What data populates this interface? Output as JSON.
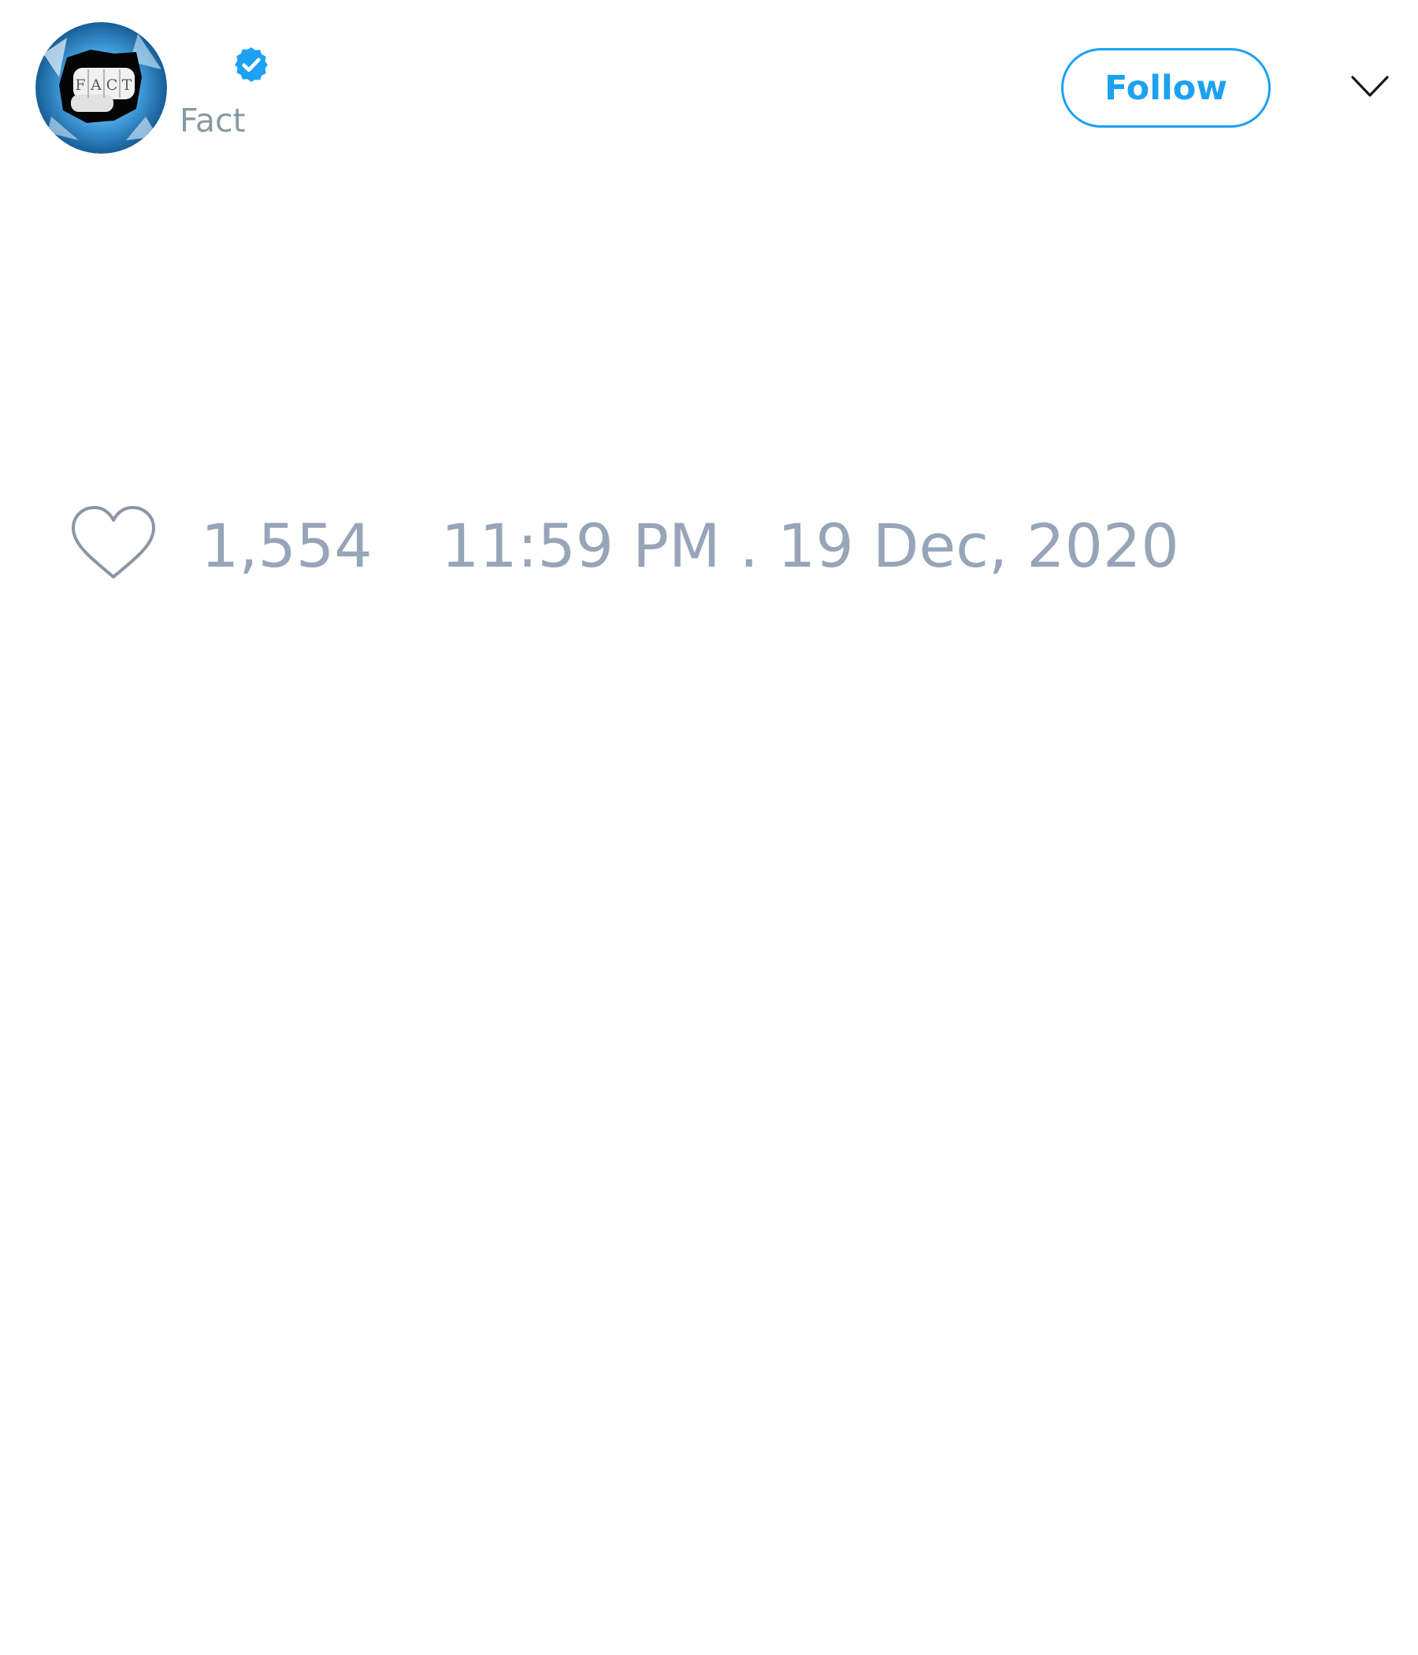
{
  "user": {
    "handle": "Fact",
    "avatar_text": "FACT",
    "verified": true,
    "avatar_icon": "fist-breaking-glass-logo",
    "verified_icon": "verified-check-badge-icon"
  },
  "header": {
    "follow_label": "Follow",
    "menu_icon": "chevron-down-icon"
  },
  "footer": {
    "like_icon": "heart-outline-icon",
    "like_count": "1,554",
    "timestamp": "11:59 PM . 19 Dec, 2020"
  },
  "colors": {
    "accent": "#1da1f2",
    "muted_text": "#8899a6",
    "heart_stroke": "#8a96a6"
  }
}
